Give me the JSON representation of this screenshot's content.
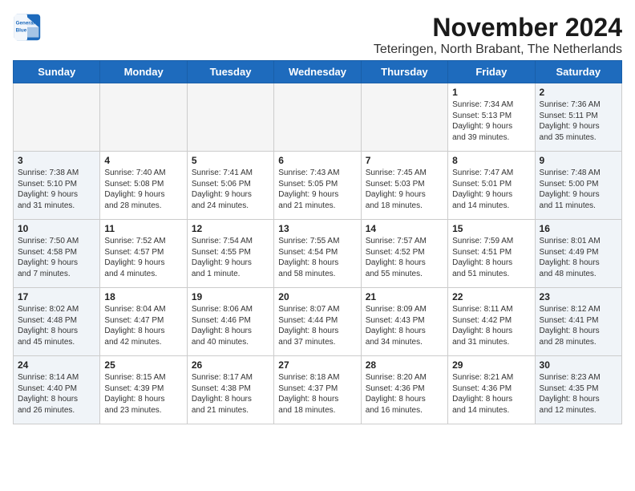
{
  "logo": {
    "line1": "General",
    "line2": "Blue"
  },
  "title": "November 2024",
  "location": "Teteringen, North Brabant, The Netherlands",
  "weekdays": [
    "Sunday",
    "Monday",
    "Tuesday",
    "Wednesday",
    "Thursday",
    "Friday",
    "Saturday"
  ],
  "weeks": [
    [
      {
        "day": "",
        "info": ""
      },
      {
        "day": "",
        "info": ""
      },
      {
        "day": "",
        "info": ""
      },
      {
        "day": "",
        "info": ""
      },
      {
        "day": "",
        "info": ""
      },
      {
        "day": "1",
        "info": "Sunrise: 7:34 AM\nSunset: 5:13 PM\nDaylight: 9 hours\nand 39 minutes."
      },
      {
        "day": "2",
        "info": "Sunrise: 7:36 AM\nSunset: 5:11 PM\nDaylight: 9 hours\nand 35 minutes."
      }
    ],
    [
      {
        "day": "3",
        "info": "Sunrise: 7:38 AM\nSunset: 5:10 PM\nDaylight: 9 hours\nand 31 minutes."
      },
      {
        "day": "4",
        "info": "Sunrise: 7:40 AM\nSunset: 5:08 PM\nDaylight: 9 hours\nand 28 minutes."
      },
      {
        "day": "5",
        "info": "Sunrise: 7:41 AM\nSunset: 5:06 PM\nDaylight: 9 hours\nand 24 minutes."
      },
      {
        "day": "6",
        "info": "Sunrise: 7:43 AM\nSunset: 5:05 PM\nDaylight: 9 hours\nand 21 minutes."
      },
      {
        "day": "7",
        "info": "Sunrise: 7:45 AM\nSunset: 5:03 PM\nDaylight: 9 hours\nand 18 minutes."
      },
      {
        "day": "8",
        "info": "Sunrise: 7:47 AM\nSunset: 5:01 PM\nDaylight: 9 hours\nand 14 minutes."
      },
      {
        "day": "9",
        "info": "Sunrise: 7:48 AM\nSunset: 5:00 PM\nDaylight: 9 hours\nand 11 minutes."
      }
    ],
    [
      {
        "day": "10",
        "info": "Sunrise: 7:50 AM\nSunset: 4:58 PM\nDaylight: 9 hours\nand 7 minutes."
      },
      {
        "day": "11",
        "info": "Sunrise: 7:52 AM\nSunset: 4:57 PM\nDaylight: 9 hours\nand 4 minutes."
      },
      {
        "day": "12",
        "info": "Sunrise: 7:54 AM\nSunset: 4:55 PM\nDaylight: 9 hours\nand 1 minute."
      },
      {
        "day": "13",
        "info": "Sunrise: 7:55 AM\nSunset: 4:54 PM\nDaylight: 8 hours\nand 58 minutes."
      },
      {
        "day": "14",
        "info": "Sunrise: 7:57 AM\nSunset: 4:52 PM\nDaylight: 8 hours\nand 55 minutes."
      },
      {
        "day": "15",
        "info": "Sunrise: 7:59 AM\nSunset: 4:51 PM\nDaylight: 8 hours\nand 51 minutes."
      },
      {
        "day": "16",
        "info": "Sunrise: 8:01 AM\nSunset: 4:49 PM\nDaylight: 8 hours\nand 48 minutes."
      }
    ],
    [
      {
        "day": "17",
        "info": "Sunrise: 8:02 AM\nSunset: 4:48 PM\nDaylight: 8 hours\nand 45 minutes."
      },
      {
        "day": "18",
        "info": "Sunrise: 8:04 AM\nSunset: 4:47 PM\nDaylight: 8 hours\nand 42 minutes."
      },
      {
        "day": "19",
        "info": "Sunrise: 8:06 AM\nSunset: 4:46 PM\nDaylight: 8 hours\nand 40 minutes."
      },
      {
        "day": "20",
        "info": "Sunrise: 8:07 AM\nSunset: 4:44 PM\nDaylight: 8 hours\nand 37 minutes."
      },
      {
        "day": "21",
        "info": "Sunrise: 8:09 AM\nSunset: 4:43 PM\nDaylight: 8 hours\nand 34 minutes."
      },
      {
        "day": "22",
        "info": "Sunrise: 8:11 AM\nSunset: 4:42 PM\nDaylight: 8 hours\nand 31 minutes."
      },
      {
        "day": "23",
        "info": "Sunrise: 8:12 AM\nSunset: 4:41 PM\nDaylight: 8 hours\nand 28 minutes."
      }
    ],
    [
      {
        "day": "24",
        "info": "Sunrise: 8:14 AM\nSunset: 4:40 PM\nDaylight: 8 hours\nand 26 minutes."
      },
      {
        "day": "25",
        "info": "Sunrise: 8:15 AM\nSunset: 4:39 PM\nDaylight: 8 hours\nand 23 minutes."
      },
      {
        "day": "26",
        "info": "Sunrise: 8:17 AM\nSunset: 4:38 PM\nDaylight: 8 hours\nand 21 minutes."
      },
      {
        "day": "27",
        "info": "Sunrise: 8:18 AM\nSunset: 4:37 PM\nDaylight: 8 hours\nand 18 minutes."
      },
      {
        "day": "28",
        "info": "Sunrise: 8:20 AM\nSunset: 4:36 PM\nDaylight: 8 hours\nand 16 minutes."
      },
      {
        "day": "29",
        "info": "Sunrise: 8:21 AM\nSunset: 4:36 PM\nDaylight: 8 hours\nand 14 minutes."
      },
      {
        "day": "30",
        "info": "Sunrise: 8:23 AM\nSunset: 4:35 PM\nDaylight: 8 hours\nand 12 minutes."
      }
    ]
  ]
}
